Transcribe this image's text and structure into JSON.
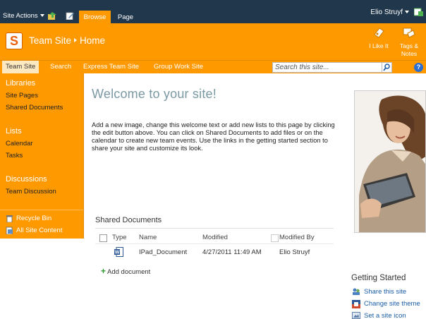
{
  "ribbon": {
    "site_actions": "Site Actions",
    "tabs": [
      {
        "label": "Browse",
        "selected": true
      },
      {
        "label": "Page",
        "selected": false
      }
    ],
    "user_name": "Elio Struyf"
  },
  "header": {
    "site_name": "Team Site",
    "page_name": "Home",
    "actions": [
      {
        "label": "I Like It",
        "icon": "like-icon"
      },
      {
        "label": "Tags & Notes",
        "icon": "tags-notes-icon"
      }
    ]
  },
  "topnav": {
    "items": [
      "Team Site",
      "Search",
      "Express Team Site",
      "Group Work Site"
    ],
    "selected_index": 0,
    "search_placeholder": "Search this site..."
  },
  "leftnav": {
    "sections": [
      {
        "heading": "Libraries",
        "items": [
          "Site Pages",
          "Shared Documents"
        ]
      },
      {
        "heading": "Lists",
        "items": [
          "Calendar",
          "Tasks"
        ]
      },
      {
        "heading": "Discussions",
        "items": [
          "Team Discussion"
        ]
      }
    ],
    "utilities": [
      {
        "label": "Recycle Bin",
        "icon": "recycle-bin-icon"
      },
      {
        "label": "All Site Content",
        "icon": "all-content-icon"
      }
    ]
  },
  "main": {
    "welcome_title": "Welcome to your site!",
    "welcome_text": "Add a new image, change this welcome text or add new lists to this page by clicking the edit button above. You can click on Shared Documents to add files or on the calendar to create new team events. Use the links in the getting started section to share your site and customize its look."
  },
  "shared_documents": {
    "title": "Shared Documents",
    "columns": [
      "Type",
      "Name",
      "Modified",
      "Modified By"
    ],
    "rows": [
      {
        "type_icon": "word-doc-icon",
        "name": "IPad_Document",
        "modified": "4/27/2011 11:49 AM",
        "modified_by": "Elio Struyf"
      }
    ],
    "add_label": "Add document"
  },
  "getting_started": {
    "title": "Getting Started",
    "links": [
      {
        "label": "Share this site",
        "icon": "share-icon"
      },
      {
        "label": "Change site theme",
        "icon": "theme-icon"
      },
      {
        "label": "Set a site icon",
        "icon": "site-icon-icon"
      }
    ]
  },
  "colors": {
    "ribbon": "#21374c",
    "accent": "#ff9900",
    "welcome_title": "#7a99a3",
    "link": "#1a5ea8"
  }
}
